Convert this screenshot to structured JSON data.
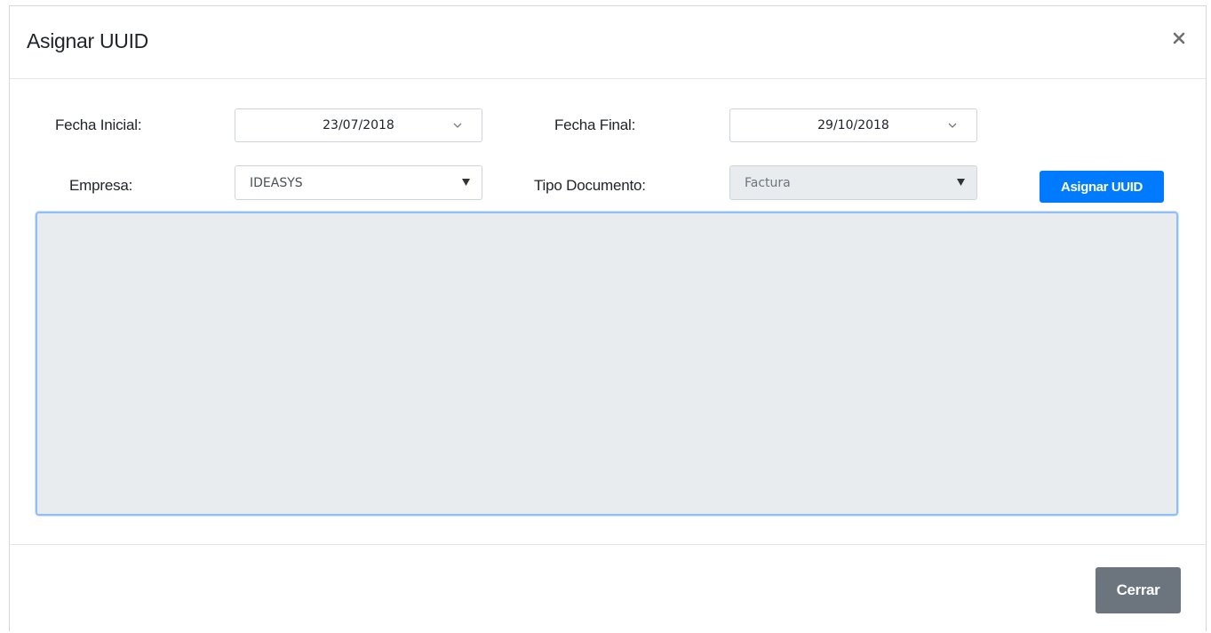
{
  "modal": {
    "title": "Asignar UUID",
    "close_icon": "close-icon"
  },
  "filters": {
    "fecha_inicial": {
      "label": "Fecha Inicial:",
      "value": "23/07/2018",
      "icon": "chevron-down-icon"
    },
    "fecha_final": {
      "label": "Fecha Final:",
      "value": "29/10/2018",
      "icon": "chevron-down-icon"
    },
    "empresa": {
      "label": "Empresa:",
      "value": "IDEASYS",
      "icon": "triangle-down-icon"
    },
    "tipo_documento": {
      "label": "Tipo Documento:",
      "value": "Factura",
      "disabled": true,
      "icon": "triangle-down-icon"
    }
  },
  "actions": {
    "assign_label": "Asignar UUID",
    "close_label": "Cerrar"
  },
  "textarea": {
    "value": ""
  },
  "colors": {
    "primary": "#007bff",
    "secondary": "#6c757d",
    "disabled_bg": "#e9ecef",
    "focus_border": "#8fbff5"
  }
}
